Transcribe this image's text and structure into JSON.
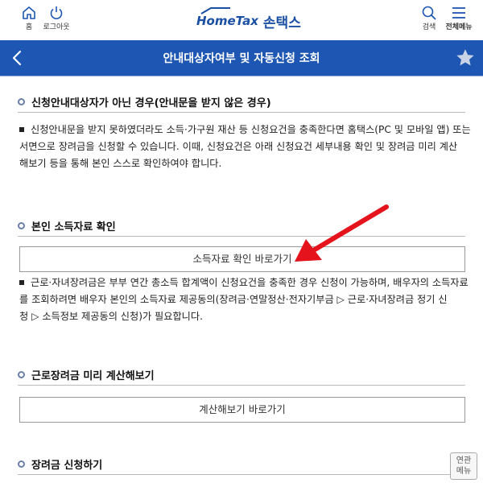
{
  "header": {
    "home_label": "홈",
    "logout_label": "로그아웃",
    "logo_en_home": "Home",
    "logo_en_tax": "Tax",
    "logo_kr": "손택스",
    "search_label": "검색",
    "menu_label": "전체메뉴"
  },
  "navbar": {
    "title": "안내대상자여부 및 자동신청 조회"
  },
  "sections": {
    "s1": {
      "title": "신청안내대상자가 아닌 경우(안내문을 받지 않은 경우)",
      "lines": [
        "신청안내문을 받지 못하였더라도 소득·가구원 재산 등 신청요건을 충족한다면 홈택스(PC 및 모바일 앱) 또는",
        "서면으로 장려금을 신청할 수 있습니다. 이때, 신청요건은 아래 신청요건 세부내용 확인 및 장려금 미리 계산",
        "해보기 등을 통해 본인 스스로 확인하여야 합니다."
      ]
    },
    "s2": {
      "title": "본인 소득자료 확인",
      "button": "소득자료 확인 바로가기",
      "lines": [
        "근로·자녀장려금은 부부 연간 총소득 합계액이 신청요건을 충족한 경우 신청이 가능하며, 배우자의 소득자료",
        "를 조회하려면 배우자 본인의 소득자료 제공동의(장려금·연말정산·전자기부금 ▷ 근로·자녀장려금 정기 신",
        "청 ▷ 소득정보 제공동의 신청)가 필요합니다."
      ]
    },
    "s3": {
      "title": "근로장려금 미리 계산해보기",
      "button": "계산해보기 바로가기"
    },
    "s4": {
      "title": "장려금 신청하기"
    }
  },
  "related": {
    "line1": "연관",
    "line2": "메뉴"
  },
  "colors": {
    "brand_blue": "#1d56b3",
    "arrow_red": "#e5141c"
  }
}
